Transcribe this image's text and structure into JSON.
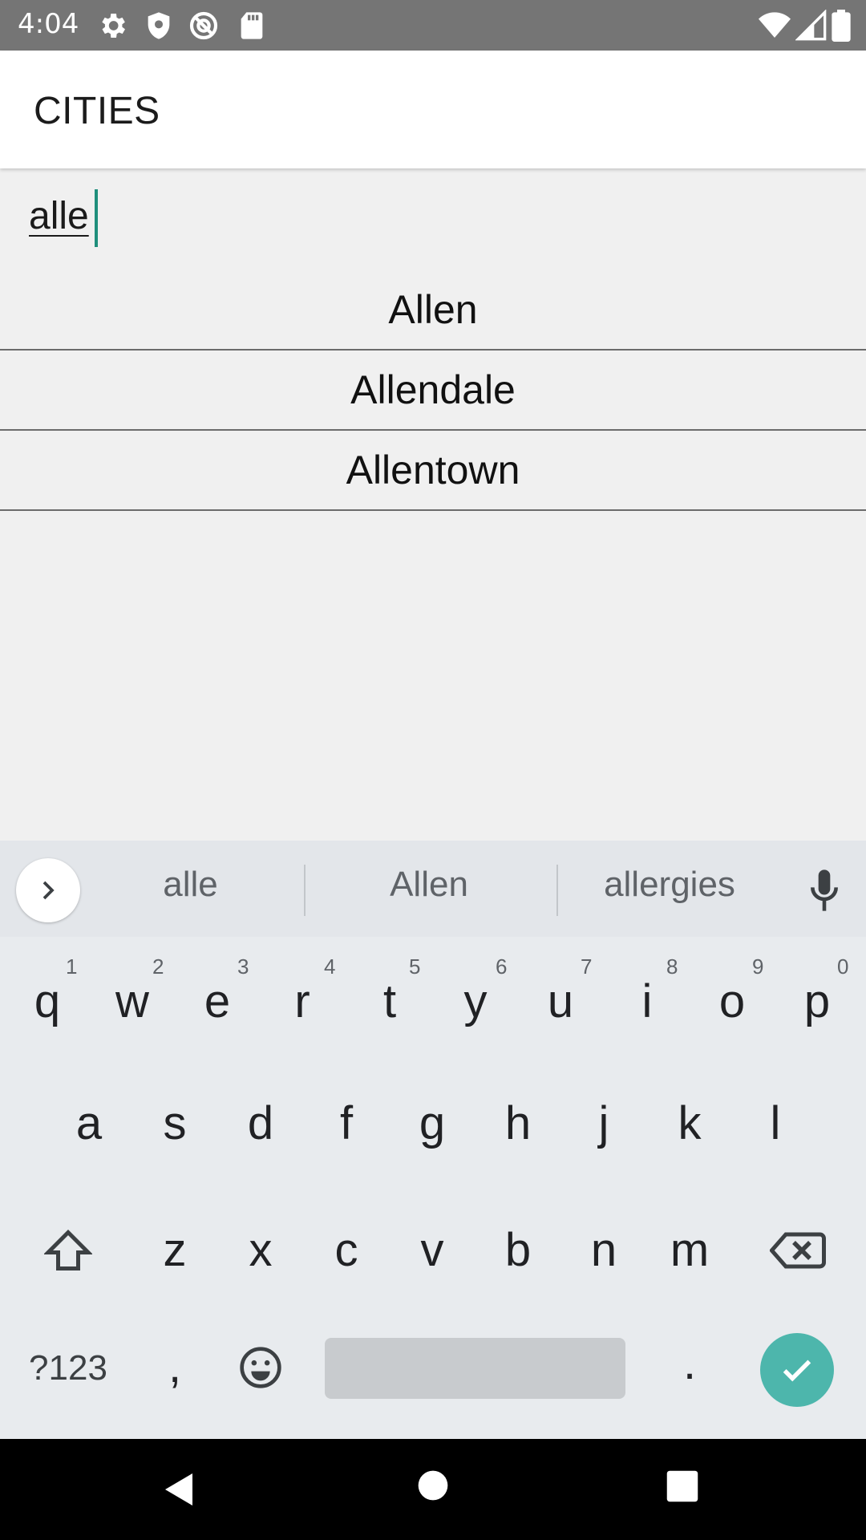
{
  "status_bar": {
    "time": "4:04",
    "icons": [
      "settings-icon",
      "shield-icon",
      "at-sign-icon",
      "sd-card-icon",
      "wifi-icon",
      "signal-icon",
      "battery-icon"
    ]
  },
  "app_bar": {
    "title": "CITIES"
  },
  "search": {
    "value": "alle"
  },
  "results": [
    "Allen",
    "Allendale",
    "Allentown"
  ],
  "keyboard": {
    "suggestions": [
      "alle",
      "Allen",
      "allergies"
    ],
    "row1": [
      {
        "key": "q",
        "hint": "1"
      },
      {
        "key": "w",
        "hint": "2"
      },
      {
        "key": "e",
        "hint": "3"
      },
      {
        "key": "r",
        "hint": "4"
      },
      {
        "key": "t",
        "hint": "5"
      },
      {
        "key": "y",
        "hint": "6"
      },
      {
        "key": "u",
        "hint": "7"
      },
      {
        "key": "i",
        "hint": "8"
      },
      {
        "key": "o",
        "hint": "9"
      },
      {
        "key": "p",
        "hint": "0"
      }
    ],
    "row2": [
      "a",
      "s",
      "d",
      "f",
      "g",
      "h",
      "j",
      "k",
      "l"
    ],
    "row3": [
      "z",
      "x",
      "c",
      "v",
      "b",
      "n",
      "m"
    ],
    "symbols_label": "?123",
    "comma": ",",
    "period": "."
  },
  "colors": {
    "accent": "#4db6ac",
    "caret": "#1f8f7c",
    "status_bar": "#757575"
  }
}
